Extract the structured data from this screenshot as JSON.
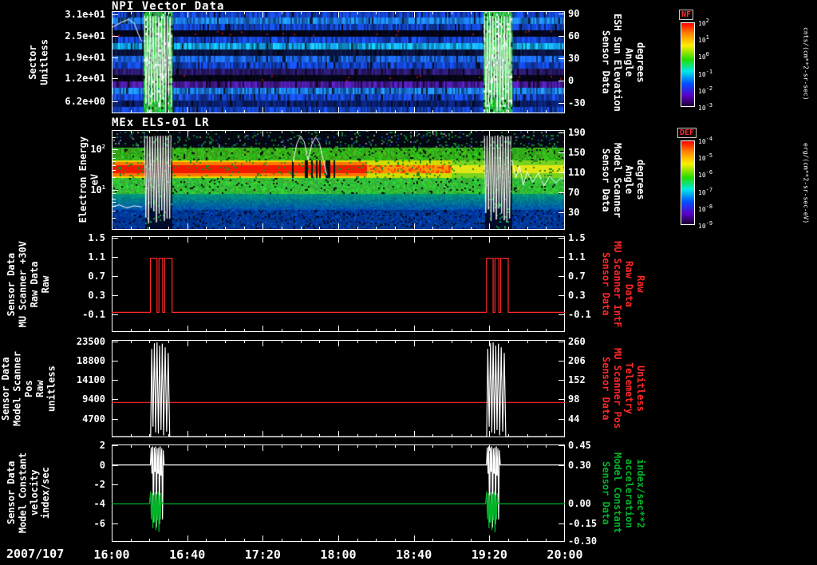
{
  "date_label": "2007/107",
  "x_axis": {
    "tick_labels": [
      "16:00",
      "16:40",
      "17:20",
      "18:00",
      "18:40",
      "19:20",
      "20:00"
    ]
  },
  "panels": {
    "p1": {
      "title": "NPI Vector Data",
      "left_label": "Sector\nUnitless",
      "right_label": "Sensor Data\nESH Sun Elevation\nAngle\ndegrees",
      "left_ticks": [
        {
          "label": "3.1e+01",
          "f": 0.03
        },
        {
          "label": "2.5e+01",
          "f": 0.24
        },
        {
          "label": "1.9e+01",
          "f": 0.45
        },
        {
          "label": "1.2e+01",
          "f": 0.66
        },
        {
          "label": "6.2e+00",
          "f": 0.88
        }
      ],
      "right_ticks": [
        {
          "label": "90",
          "f": 0.02
        },
        {
          "label": "60",
          "f": 0.24
        },
        {
          "label": "30",
          "f": 0.46
        },
        {
          "label": "0",
          "f": 0.68
        },
        {
          "label": "-30",
          "f": 0.9
        }
      ]
    },
    "p2": {
      "title": "MEx ELS-01 LR",
      "left_label": "Electron Energy\neV",
      "right_label": "Sensor Data\nModel Scanner\nAngle\ndegrees",
      "left_ticks": [
        {
          "label": "10^2",
          "f": 0.19
        },
        {
          "label": "10^1",
          "f": 0.6
        }
      ],
      "right_ticks": [
        {
          "label": "190",
          "f": 0.02
        },
        {
          "label": "150",
          "f": 0.22
        },
        {
          "label": "110",
          "f": 0.42
        },
        {
          "label": "70",
          "f": 0.62
        },
        {
          "label": "30",
          "f": 0.82
        }
      ]
    },
    "p3": {
      "left_label": "Sensor Data\nMU Scanner +30V\nRaw Data\nRaw",
      "right_label": "Sensor Data\nMU Scanner IntF\nRaw Data\nRaw",
      "left_ticks": [
        {
          "label": "1.5",
          "f": 0.02
        },
        {
          "label": "1.1",
          "f": 0.22
        },
        {
          "label": "0.7",
          "f": 0.42
        },
        {
          "label": "0.3",
          "f": 0.62
        },
        {
          "label": "-0.1",
          "f": 0.82
        }
      ],
      "right_ticks": [
        {
          "label": "1.5",
          "f": 0.02
        },
        {
          "label": "1.1",
          "f": 0.22
        },
        {
          "label": "0.7",
          "f": 0.42
        },
        {
          "label": "0.3",
          "f": 0.62
        },
        {
          "label": "-0.1",
          "f": 0.82
        }
      ]
    },
    "p4": {
      "left_label": "Sensor Data\nModel Scanner Pos\nRaw\nunitless",
      "right_label": "Sensor Data\nMU Scanner Pos\nTelemetry\nUnitless",
      "left_ticks": [
        {
          "label": "23500",
          "f": 0.02
        },
        {
          "label": "18800",
          "f": 0.21
        },
        {
          "label": "14100",
          "f": 0.41
        },
        {
          "label": "9400",
          "f": 0.61
        },
        {
          "label": "4700",
          "f": 0.81
        }
      ],
      "right_ticks": [
        {
          "label": "260",
          "f": 0.02
        },
        {
          "label": "206",
          "f": 0.21
        },
        {
          "label": "152",
          "f": 0.41
        },
        {
          "label": "98",
          "f": 0.61
        },
        {
          "label": "44",
          "f": 0.81
        }
      ]
    },
    "p5": {
      "left_label": "Sensor Data\nModel Constant\nvelocity\nindex/sec",
      "right_label": "Sensor Data\nModel Constant\nacceleration\nindex/sec**2",
      "left_ticks": [
        {
          "label": "2",
          "f": 0.01
        },
        {
          "label": "0",
          "f": 0.21
        },
        {
          "label": "-2",
          "f": 0.41
        },
        {
          "label": "-4",
          "f": 0.61
        },
        {
          "label": "-6",
          "f": 0.81
        }
      ],
      "right_ticks": [
        {
          "label": "0.45",
          "f": 0.01
        },
        {
          "label": "0.30",
          "f": 0.21
        },
        {
          "label": "0.00",
          "f": 0.61
        },
        {
          "label": "-0.15",
          "f": 0.81
        },
        {
          "label": "-0.30",
          "f": 0.99
        }
      ]
    }
  },
  "colorbars": {
    "nf": {
      "name": "NF",
      "unit": "cnts/(cm**2-sr-sec)",
      "ticks": [
        "10^2",
        "10^1",
        "10^0",
        "10^-1",
        "10^-2",
        "10^-3"
      ]
    },
    "def": {
      "name": "DEF",
      "unit": "erg/(cm**2-sr-sec-eV)",
      "ticks": [
        "10^-4",
        "10^-5",
        "10^-6",
        "10^-7",
        "10^-8",
        "10^-9"
      ]
    }
  },
  "chart_data": [
    {
      "id": "npi_spectrogram",
      "type": "heatmap",
      "title": "NPI Vector Data",
      "x_minutes": [
        0,
        240
      ],
      "x_tick_labels": [
        "16:00",
        "16:40",
        "17:20",
        "18:00",
        "18:40",
        "19:20",
        "20:00"
      ],
      "y_label": "Sector (Unitless)",
      "y_tick_values": [
        31,
        25,
        19,
        12,
        6.2
      ],
      "right_y_label": "ESH Sun Elevation Angle (degrees)",
      "right_y_tick_values": [
        90,
        60,
        30,
        0,
        -30
      ],
      "value_label": "NF cnts/(cm**2-sr-sec)",
      "colormap": "rainbow",
      "event_windows_minutes": [
        [
          17,
          32
        ],
        [
          197,
          212
        ]
      ],
      "row_colors": [
        "#1545d2",
        "#1b7ff0",
        "#1243c8",
        "#05051a",
        "#1546d4",
        "#14a8f0",
        "#0a1440",
        "#1a63e8",
        "#1243c8",
        "#2a1a70",
        "#060618",
        "#4a1aa0",
        "#1b7ff0",
        "#1546d4",
        "#0a2070",
        "#1243c8"
      ],
      "overlay": {
        "color": "#ffffff",
        "pre_trace": [
          [
            0,
            0.16
          ],
          [
            5,
            0.11
          ],
          [
            9,
            0.08
          ],
          [
            12,
            0.12
          ],
          [
            14,
            0.22
          ],
          [
            16,
            0.3
          ]
        ],
        "zigzag": {
          "top": 0.05,
          "bottom": 0.9,
          "period": 1.5
        }
      }
    },
    {
      "id": "els_spectrogram",
      "type": "heatmap",
      "title": "MEx ELS-01 LR",
      "x_minutes": [
        0,
        240
      ],
      "y_scale": "log",
      "y_label": "Electron Energy (eV)",
      "y_tick_values": [
        100,
        10
      ],
      "right_y_label": "Model Scanner Angle (degrees)",
      "right_y_tick_values": [
        190,
        150,
        110,
        70,
        30
      ],
      "value_label": "DEF erg/(cm**2-sr-sec-eV)",
      "colormap": "rainbow",
      "event_windows_minutes": [
        [
          17,
          32
        ],
        [
          197,
          212
        ]
      ],
      "hot_band": {
        "center_frac": 0.385,
        "halfwidth_frac": 0.085,
        "red_until_minute": 135,
        "orange_until_minute": 180
      },
      "disturbed_minutes": [
        95,
        118
      ],
      "overlay": {
        "color": "#ffffff",
        "segments": [
          [
            [
              0,
              0.77
            ],
            [
              4,
              0.75
            ],
            [
              8,
              0.78
            ],
            [
              12,
              0.76
            ],
            [
              16,
              0.77
            ]
          ],
          [
            [
              96,
              0.32
            ],
            [
              98,
              0.14
            ],
            [
              100,
              0.06
            ],
            [
              102,
              0.12
            ],
            [
              104,
              0.3
            ],
            [
              106,
              0.14
            ],
            [
              108,
              0.07
            ],
            [
              110,
              0.13
            ],
            [
              112,
              0.3
            ],
            [
              114,
              0.45
            ]
          ],
          [
            [
              212,
              0.3
            ],
            [
              214,
              0.48
            ],
            [
              216,
              0.36
            ],
            [
              218,
              0.55
            ],
            [
              220,
              0.42
            ],
            [
              223,
              0.52
            ],
            [
              226,
              0.43
            ],
            [
              229,
              0.56
            ],
            [
              232,
              0.46
            ],
            [
              235,
              0.53
            ],
            [
              238,
              0.48
            ],
            [
              240,
              0.5
            ]
          ]
        ],
        "zigzag": {
          "top": 0.06,
          "bottom": 0.86,
          "period": 1.4
        }
      }
    },
    {
      "id": "mu_scanner_30v",
      "type": "line",
      "ylim": [
        1.54,
        -0.46
      ],
      "series": [
        {
          "name": "MU Scanner +30V Raw Data",
          "color": "#ff2828",
          "baseline": -0.05,
          "event_starts": [
            20,
            198
          ],
          "event_shape": [
            [
              0.5,
              -0.05
            ],
            [
              0.5,
              1.08
            ],
            [
              4.0,
              1.08
            ],
            [
              4.0,
              -0.05
            ],
            [
              5.0,
              -0.05
            ],
            [
              5.0,
              1.08
            ],
            [
              7.0,
              1.08
            ],
            [
              7.0,
              -0.05
            ],
            [
              8.0,
              -0.05
            ],
            [
              8.0,
              1.08
            ],
            [
              12.0,
              1.08
            ],
            [
              12.0,
              -0.05
            ]
          ]
        }
      ]
    },
    {
      "id": "model_scanner_pos",
      "type": "line",
      "ylim": [
        24000,
        0
      ],
      "series": [
        {
          "name": "MU Scanner Pos Telemetry",
          "color": "#ff2828",
          "baseline": 8600,
          "event_starts": [],
          "event_shape": []
        },
        {
          "name": "Model Scanner Pos Raw",
          "color": "#ffffff",
          "baseline": 150,
          "event_starts": [
            20,
            198
          ],
          "event_shape": [
            [
              0.6,
              150
            ],
            [
              1.2,
              21800
            ],
            [
              1.9,
              2600
            ],
            [
              2.6,
              23200
            ],
            [
              3.3,
              1200
            ],
            [
              4.0,
              23400
            ],
            [
              4.7,
              900
            ],
            [
              5.4,
              22600
            ],
            [
              6.1,
              1800
            ],
            [
              6.8,
              23100
            ],
            [
              7.5,
              500
            ],
            [
              8.3,
              22200
            ],
            [
              9.1,
              1400
            ],
            [
              9.9,
              20800
            ],
            [
              10.7,
              150
            ]
          ]
        }
      ]
    },
    {
      "id": "model_constant",
      "type": "line",
      "ylim": [
        2.1,
        -7.9
      ],
      "series": [
        {
          "name": "Model Constant velocity",
          "color": "#ffffff",
          "baseline": 0,
          "event_starts": [
            20,
            198
          ],
          "event_shape": [
            [
              0.5,
              0
            ],
            [
              0.9,
              1.8
            ],
            [
              1.3,
              -0.9
            ],
            [
              1.7,
              1.9
            ],
            [
              2.1,
              -5.9
            ],
            [
              2.5,
              1.8
            ],
            [
              2.9,
              -0.7
            ],
            [
              3.3,
              1.9
            ],
            [
              3.7,
              -6.4
            ],
            [
              4.1,
              1.7
            ],
            [
              4.5,
              -0.9
            ],
            [
              4.9,
              1.8
            ],
            [
              5.3,
              -6.1
            ],
            [
              5.7,
              1.9
            ],
            [
              6.1,
              -1.1
            ],
            [
              6.5,
              1.7
            ],
            [
              6.9,
              -5.6
            ],
            [
              7.3,
              1.5
            ],
            [
              7.8,
              0
            ]
          ]
        },
        {
          "name": "Model Constant acceleration",
          "color": "#00b428",
          "baseline": -4,
          "event_starts": [
            20,
            198
          ],
          "event_shape": [
            [
              0.6,
              -2.7
            ],
            [
              1.0,
              -5.6
            ],
            [
              1.4,
              -2.9
            ],
            [
              1.8,
              -6.5
            ],
            [
              2.2,
              -3.1
            ],
            [
              2.6,
              -5.9
            ],
            [
              3.0,
              -2.8
            ],
            [
              3.4,
              -6.7
            ],
            [
              3.8,
              -3.0
            ],
            [
              4.2,
              -5.7
            ],
            [
              4.6,
              -2.7
            ],
            [
              5.0,
              -6.9
            ],
            [
              5.4,
              -3.1
            ],
            [
              5.8,
              -5.6
            ],
            [
              6.2,
              -2.9
            ],
            [
              6.6,
              -4.0
            ],
            [
              7.5,
              -4.0
            ]
          ]
        }
      ]
    }
  ]
}
